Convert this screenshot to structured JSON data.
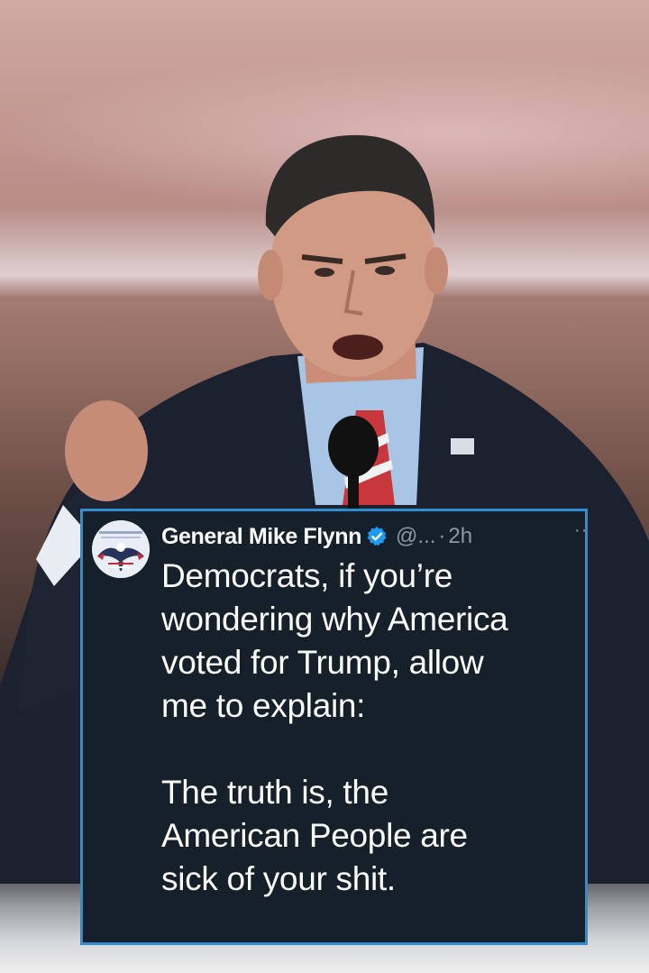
{
  "tweet": {
    "author_name": "General Mike Flynn",
    "handle": "@...",
    "separator": "·",
    "time": "2h",
    "more_label": "··",
    "paragraph_1_lines": [
      "Democrats, if you’re",
      "wondering why America",
      "voted for Trump, allow",
      "me to explain:"
    ],
    "paragraph_2_lines": [
      "The truth is, the",
      "American People are",
      "sick of your shit."
    ],
    "verified_badge_icon": "verified-check-icon",
    "avatar_icon": "eagle-flag-avatar-icon"
  },
  "colors": {
    "card_background": "#15202b",
    "card_border": "#2d8ed4",
    "text_primary": "#ffffff",
    "text_secondary": "#8b98a5",
    "verified_blue": "#1d9bf0"
  }
}
